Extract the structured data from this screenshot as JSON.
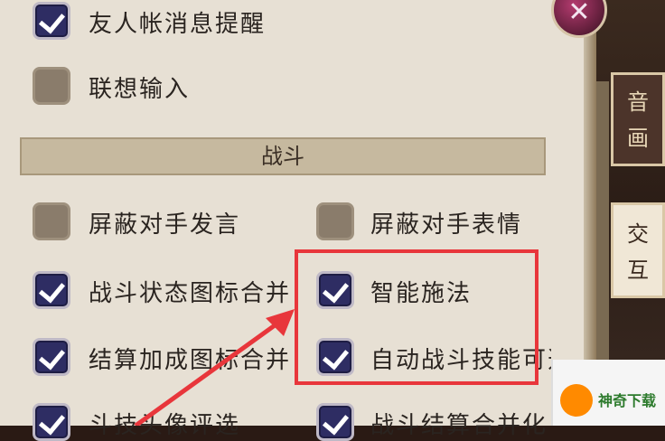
{
  "options": [
    {
      "label": "友人帐消息提醒",
      "checked": true
    },
    {
      "label": "联想输入",
      "checked": false
    }
  ],
  "section_title": "战斗",
  "battle_options": [
    {
      "label": "屏蔽对手发言",
      "checked": false
    },
    {
      "label": "屏蔽对手表情",
      "checked": false
    },
    {
      "label": "战斗状态图标合并",
      "checked": true
    },
    {
      "label": "智能施法",
      "checked": true
    },
    {
      "label": "结算加成图标合并",
      "checked": true
    },
    {
      "label": "自动战斗技能可选",
      "checked": true
    },
    {
      "label": "斗技头像评选",
      "checked": true
    },
    {
      "label": "战斗结算合并化",
      "checked": true
    }
  ],
  "side_tabs": [
    {
      "label": "音\n画"
    },
    {
      "label": "交\n互"
    }
  ],
  "close_symbol": "✕",
  "watermark_text": "神奇下载",
  "colors": {
    "accent_red": "#e8363b",
    "checkbox_on": "#2e2d63",
    "panel_bg": "#e7e0d4"
  }
}
